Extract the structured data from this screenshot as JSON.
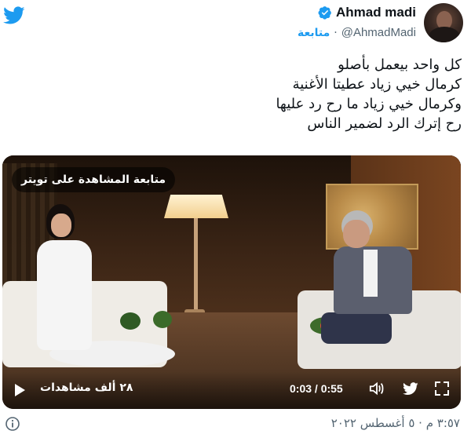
{
  "colors": {
    "twitter_blue": "#1d9bf0",
    "text_primary": "#0f1419",
    "text_secondary": "#536471",
    "verified_blue": "#1d9bf0"
  },
  "header": {
    "logo_icon": "twitter-bird-icon",
    "display_name": "Ahmad madi",
    "verified_icon": "verified-badge-icon",
    "handle": "@AhmadMadi",
    "separator": "·",
    "follow_label": "متابعة"
  },
  "tweet": {
    "lines": [
      "كل واحد بيعمل بأصلو",
      "كرمال خيي زياد عطيتا الأغنية",
      "وكرمال خيي زياد ما رح رد عليها",
      "رح إترك الرد لضمير الناس"
    ]
  },
  "video": {
    "badge": "متابعة المشاهدة على تويتر",
    "views": "٢٨ ألف مشاهدات",
    "time": "0:03 / 0:55",
    "play_icon": "play-icon",
    "volume_icon": "volume-icon",
    "twitter_icon": "twitter-bird-icon",
    "expand_icon": "expand-icon"
  },
  "footer": {
    "timestamp": "٣:٥٧ م · ٥ أغسطس ٢٠٢٢",
    "info_icon": "info-icon"
  }
}
